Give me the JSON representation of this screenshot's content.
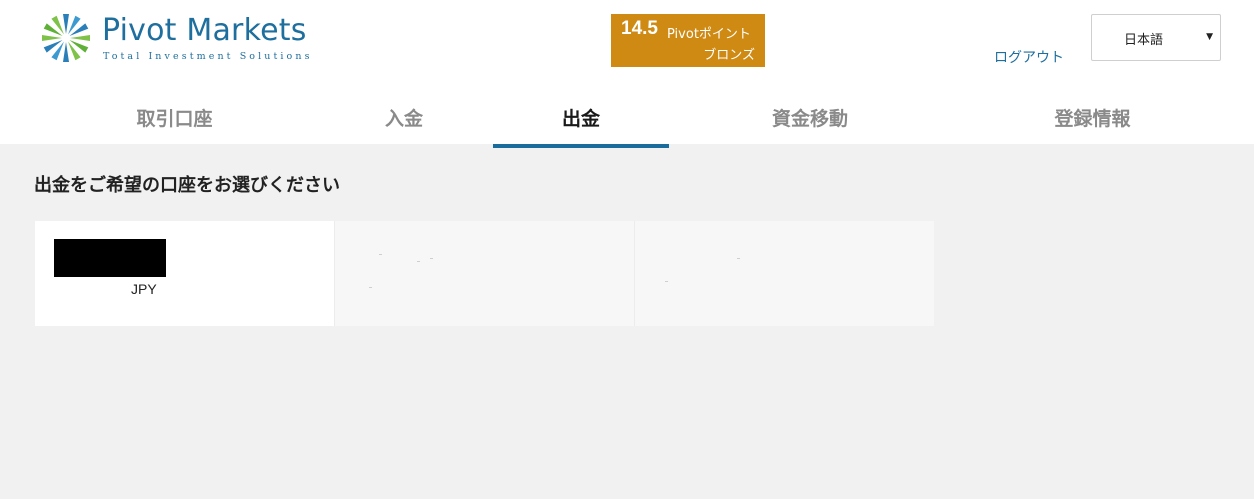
{
  "brand": {
    "name": "Pivot Markets",
    "tagline": "Total Investment Solutions"
  },
  "points": {
    "value": "14.5",
    "unit": "Pivotポイント",
    "rank": "ブロンズ",
    "color": "#cf8a14"
  },
  "header": {
    "logout_label": "ログアウト",
    "language": {
      "selected": "日本語"
    }
  },
  "tabs": [
    {
      "label": "取引口座",
      "active": false
    },
    {
      "label": "入金",
      "active": false
    },
    {
      "label": "出金",
      "active": true
    },
    {
      "label": "資金移動",
      "active": false
    },
    {
      "label": "登録情報",
      "active": false
    }
  ],
  "main": {
    "title": "出金をご希望の口座をお選びください",
    "accounts": [
      {
        "currency": "JPY"
      }
    ]
  },
  "colors": {
    "accent": "#1a6c9c",
    "brand_text": "#1e6f9e",
    "background": "#f1f1f1"
  }
}
